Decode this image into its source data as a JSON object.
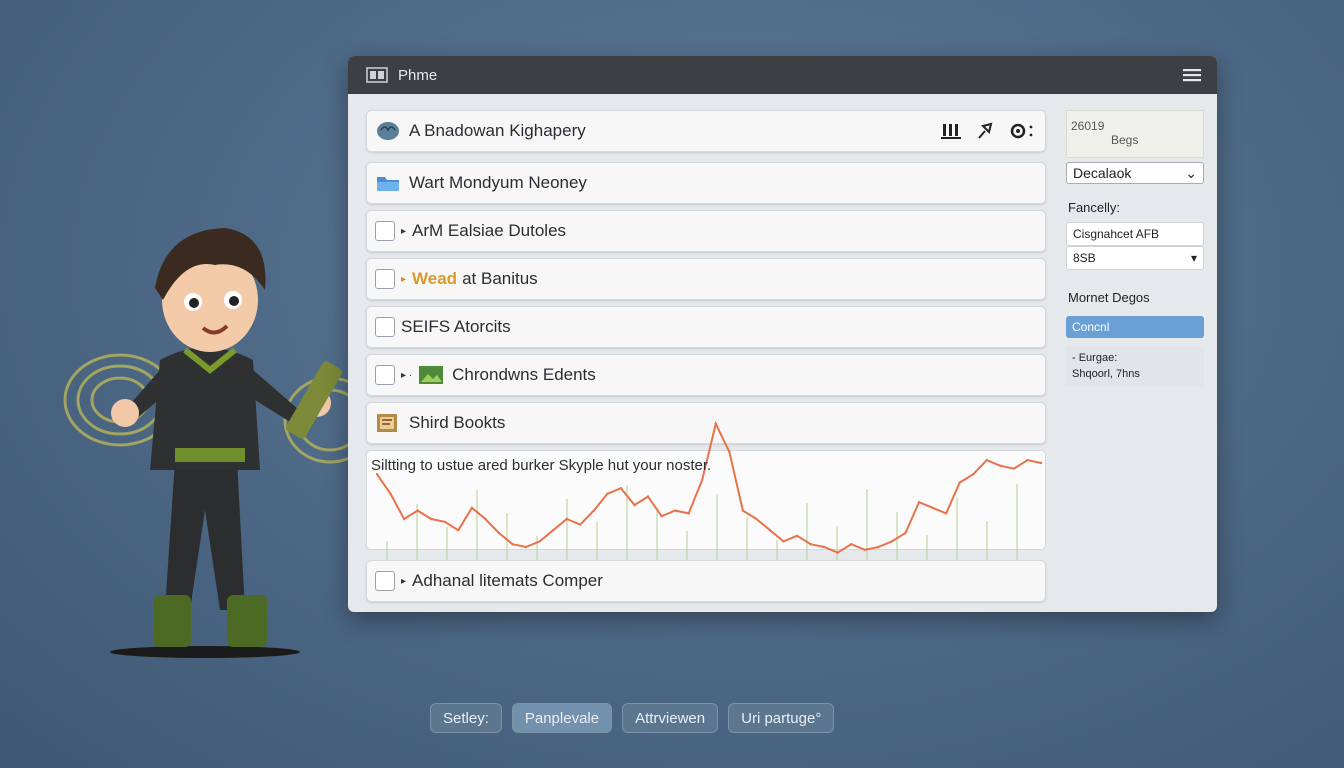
{
  "window": {
    "title": "Phme",
    "menu_icon": "hamburger-icon"
  },
  "list": {
    "rows": [
      {
        "label": "A Bnadowan Kighapery",
        "icon": "brain-icon"
      },
      {
        "label": "Wart Mondyum Neoney",
        "icon": "folder-icon"
      },
      {
        "label": "ArM Ealsiae Dutoles",
        "icon": "checkbox"
      },
      {
        "label_highlight": "Wead",
        "label": "at Banitus",
        "icon": "checkbox"
      },
      {
        "label": "SEIFS Atorcits",
        "icon": "checkbox"
      },
      {
        "label": "Chrondwns Edents",
        "icon": "image-icon"
      },
      {
        "label": "Shird Bookts",
        "icon": "book-icon"
      },
      {
        "label": "Adhanal litemats Comper",
        "icon": "checkbox"
      }
    ],
    "tool_icons": [
      "columns-icon",
      "pin-icon",
      "settings-icon"
    ]
  },
  "chart_caption": "Siltting to ustue ared burker Skyple hut your noster.",
  "chart_data": {
    "type": "line",
    "series_color": "#e8734a",
    "grid_color": "#b8d4a0",
    "values": [
      62,
      48,
      30,
      36,
      30,
      28,
      22,
      38,
      30,
      20,
      12,
      10,
      14,
      22,
      30,
      26,
      36,
      48,
      52,
      40,
      46,
      32,
      36,
      34,
      58,
      98,
      78,
      36,
      30,
      22,
      14,
      18,
      12,
      10,
      6,
      12,
      8,
      10,
      14,
      20,
      42,
      38,
      34,
      56,
      62,
      72,
      68,
      66,
      72,
      70
    ]
  },
  "side": {
    "date_line1": "26019",
    "date_line2": "Begs",
    "select_value": "Decalaok",
    "label1": "Fancelly:",
    "field1": "Cisgnahcet AFB",
    "field2": "8SB",
    "label2": "Mornet Degos",
    "primary_button": "Concnl",
    "note_line1": "- Eurgae:",
    "note_line2": "Shqoorl, 7hns"
  },
  "bottom_bar": {
    "items": [
      {
        "label": "Setley:",
        "active": false
      },
      {
        "label": "Panplevale",
        "active": true
      },
      {
        "label": "Attrviewen",
        "active": false
      },
      {
        "label": "Uri partuge°",
        "active": false
      }
    ]
  }
}
